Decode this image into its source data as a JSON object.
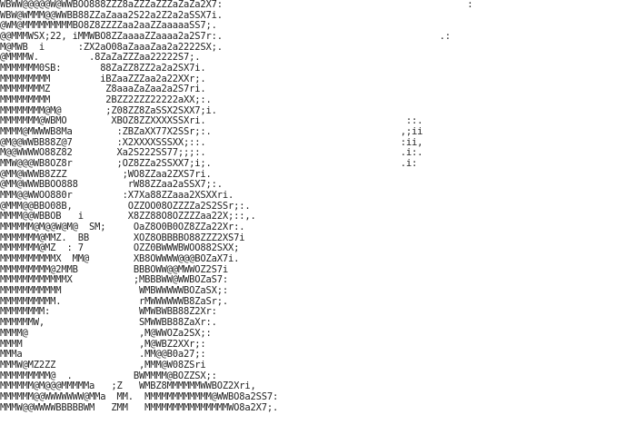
{
  "ascii_art": {
    "text_color": "#222222",
    "background_color": "#ffffff",
    "lines": [
      "WBWW@@@@@W@WWBOO888ZZZ8aZZZaZZZaZaZa2X7:                                            :",
      "WBW@WMMM@@WWBB88ZZaZaaa2S22a2Z2a2aSSX7i.",
      "@WM@MMMMMMMMMBO8Z8ZZZZaa2aaZZaaaaaSS7;.",
      "@@MMMWSX;22, iMMWBO8ZZaaaaZZaaaa2a2S7r:.                                       .:",
      "M@MWB  i      :ZX2aO08aZaaaZaa2a2222SX;.",
      "@MMMMW.         .8ZaZaZZZaa22222S7;.",
      "MMMMMMM0SB:       88ZaZZ8ZZ2a2a2SX7i.",
      "MMMMMMMMM         iBZaaZZZaa2a22XXr;.",
      "MMMMMMMMZ          Z8aaaZaZaa2a2S7ri.",
      "MMMMMMMMM          2BZZ2ZZZ22222aXX;:.",
      "MMMMMMMM@M@        ;Z08ZZ8ZaSSX2SXX7;i.",
      "MMMMMMM@WBMO        XBOZ8ZZXXXXSSXri.                                    ::.",
      "MMMM@MWWWB8Ma        :ZBZaXX77X2SSr;:.                                  ,;ii",
      "@M@@WWBB88Z@7        :X2XXXXSSSXX;::.                                   :ii,",
      "M@@WWWWO88Z82        Xa2S222SS77;;;:.                                   .i:.",
      "MMW@@@WB8OZ8r        ;OZ8ZZa2SSXX7;i;.                                  .i:",
      "@MM@WWWB8ZZZ          ;WO8ZZaa2ZXS7ri.",
      "@MM@WWWBBOO888         rW88ZZaa2aSSX7;:.",
      "MMM@@WWOO880r         :X7Xa88ZZaaa2XSXXri.",
      "@MMM@@BBO08B,          OZZOO08OZZZZa2S2SSr;:.",
      "MMMM@@WBBOB   i        X8ZZ88O8OZZZZaa22X;::,.",
      "MMMMMM@M@@W@M@  SM;     OaZ8O0B0OZ8ZZa22Xr:.",
      "MMMMMMM@MMZ.  BB        XOZ8OBBBBO88ZZZ2XS7i",
      "MMMMMMM@MZ  : 7         OZZ0BWWWBWOO882SXX;",
      "MMMMMMMMMMX  MM@        XB8OWWWW@@@BOZaX7i.",
      "MMMMMMMMM@2MMB          BBBOWW@@MWWOZ2S7i",
      "MMMMMMMMMMMMX           ;MBBBWW@WWBOZaS7:",
      "MMMMMMMMMMM              WMBWWWWWBOZaSX;:",
      "MMMMMMMMMM.              rMWWWWWWB8ZaSr;.",
      "MMMMMMMM:                WMWBWBB88Z2Xr:",
      "MMMMMMW,                 SMWWBB88ZaXr:.",
      "MMMM@                    ,M@WWOZa2SX;:",
      "MMMM                     ,M@WBZ2XXr;:",
      "MMMa                     .MM@@B0a27;:",
      "MMMW@MZ2ZZ               ,MMM@W08ZSri",
      "MMMMMMMMM@  .           BWMMMM@BOZZSX;:",
      "MMMMMM@M@@@MMMMMa   ;Z   WMBZ8MMMMMMWWBOZ2Xri,",
      "MMMMMM@@WWWWWWW@MMa  MM.  MMMMMMMMMMMM@WWBO8a2SS7:",
      "MMMW@@WWWWBBBBBWM   ZMM   MMMMMMMMMMMMMMMWO8a2X7;."
    ]
  }
}
